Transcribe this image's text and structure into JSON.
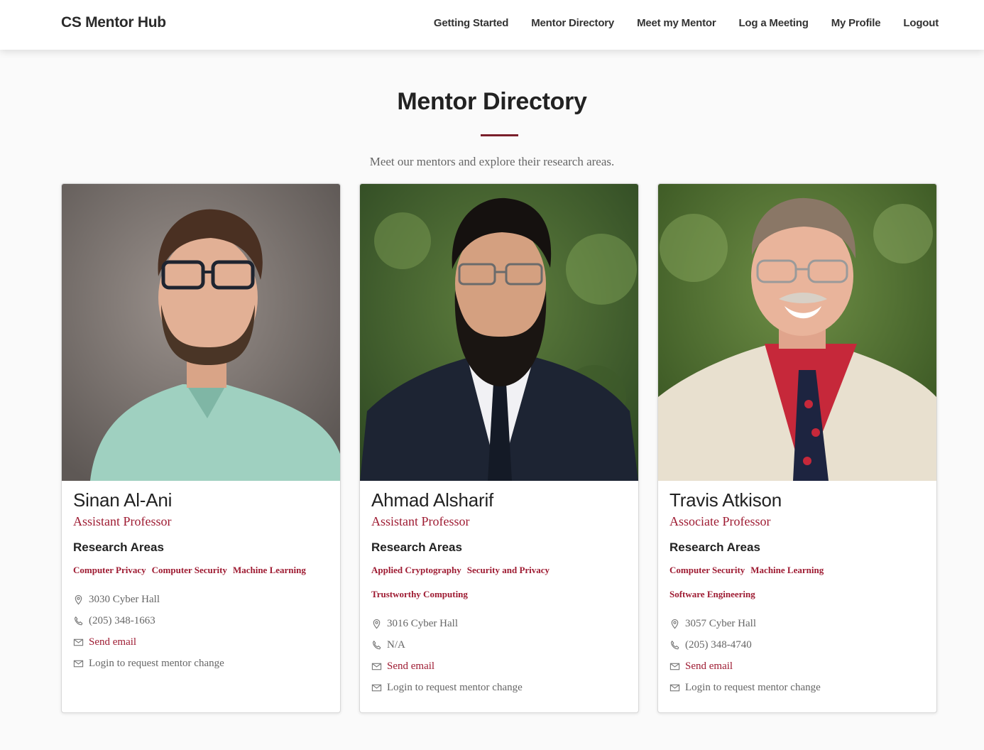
{
  "nav": {
    "brand": "CS Mentor Hub",
    "links": [
      "Getting Started",
      "Mentor Directory",
      "Meet my Mentor",
      "Log a Meeting",
      "My Profile",
      "Logout"
    ]
  },
  "page": {
    "title": "Mentor Directory",
    "subtitle": "Meet our mentors and explore their research areas."
  },
  "mentors": [
    {
      "name": "Sinan Al-Ani",
      "role": "Assistant Professor",
      "research_heading": "Research Areas",
      "tags": [
        "Computer Privacy",
        "Computer Security",
        "Machine Learning"
      ],
      "office": "3030 Cyber Hall",
      "phone": "(205) 348-1663",
      "email_label": "Send email",
      "request_label": "Login to request mentor change"
    },
    {
      "name": "Ahmad Alsharif",
      "role": "Assistant Professor",
      "research_heading": "Research Areas",
      "tags": [
        "Applied Cryptography",
        "Security and Privacy",
        "Trustworthy Computing"
      ],
      "office": "3016 Cyber Hall",
      "phone": "N/A",
      "email_label": "Send email",
      "request_label": "Login to request mentor change"
    },
    {
      "name": "Travis Atkison",
      "role": "Associate Professor",
      "research_heading": "Research Areas",
      "tags": [
        "Computer Security",
        "Machine Learning",
        "Software Engineering"
      ],
      "office": "3057 Cyber Hall",
      "phone": "(205) 348-4740",
      "email_label": "Send email",
      "request_label": "Login to request mentor change"
    }
  ],
  "icons": {
    "office": "map-pin-icon",
    "phone": "phone-icon",
    "email": "envelope-icon",
    "request": "envelope-icon"
  },
  "colors": {
    "accent": "#9e1b32",
    "title_rule": "#7a1f2b"
  }
}
